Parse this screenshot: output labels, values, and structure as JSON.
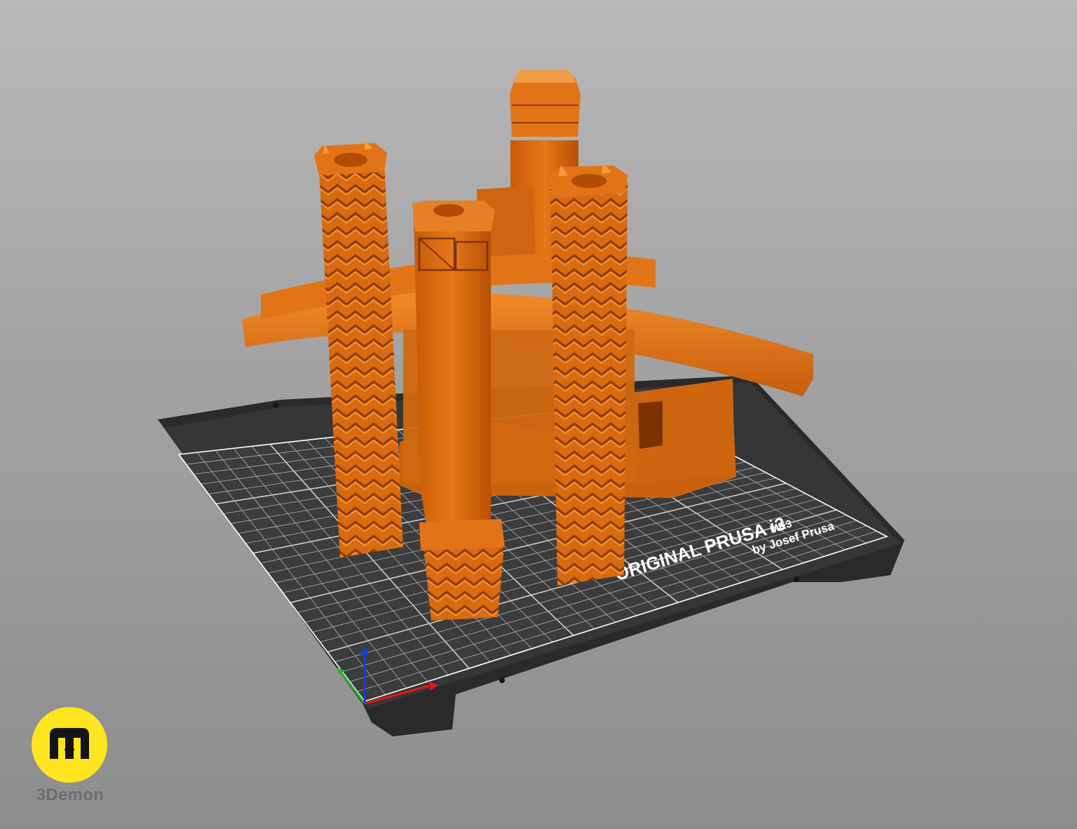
{
  "bed": {
    "brand_line": "ORIGINAL PRUSA i3",
    "model": "MK3",
    "byline": "by Josef Prusa"
  },
  "colors": {
    "background_top": "#b8b8b8",
    "background_bottom": "#8d8d8d",
    "bed_sheet": "#333333",
    "bed_grid": "#ffffff",
    "model_orange": "#e07014",
    "axis_x": "#e01a1a",
    "axis_y": "#22b822",
    "axis_z": "#1a3ae0",
    "logo_yellow": "#ffe51f"
  },
  "logo": {
    "text": "3Demon",
    "icon": "m-logo-icon"
  }
}
